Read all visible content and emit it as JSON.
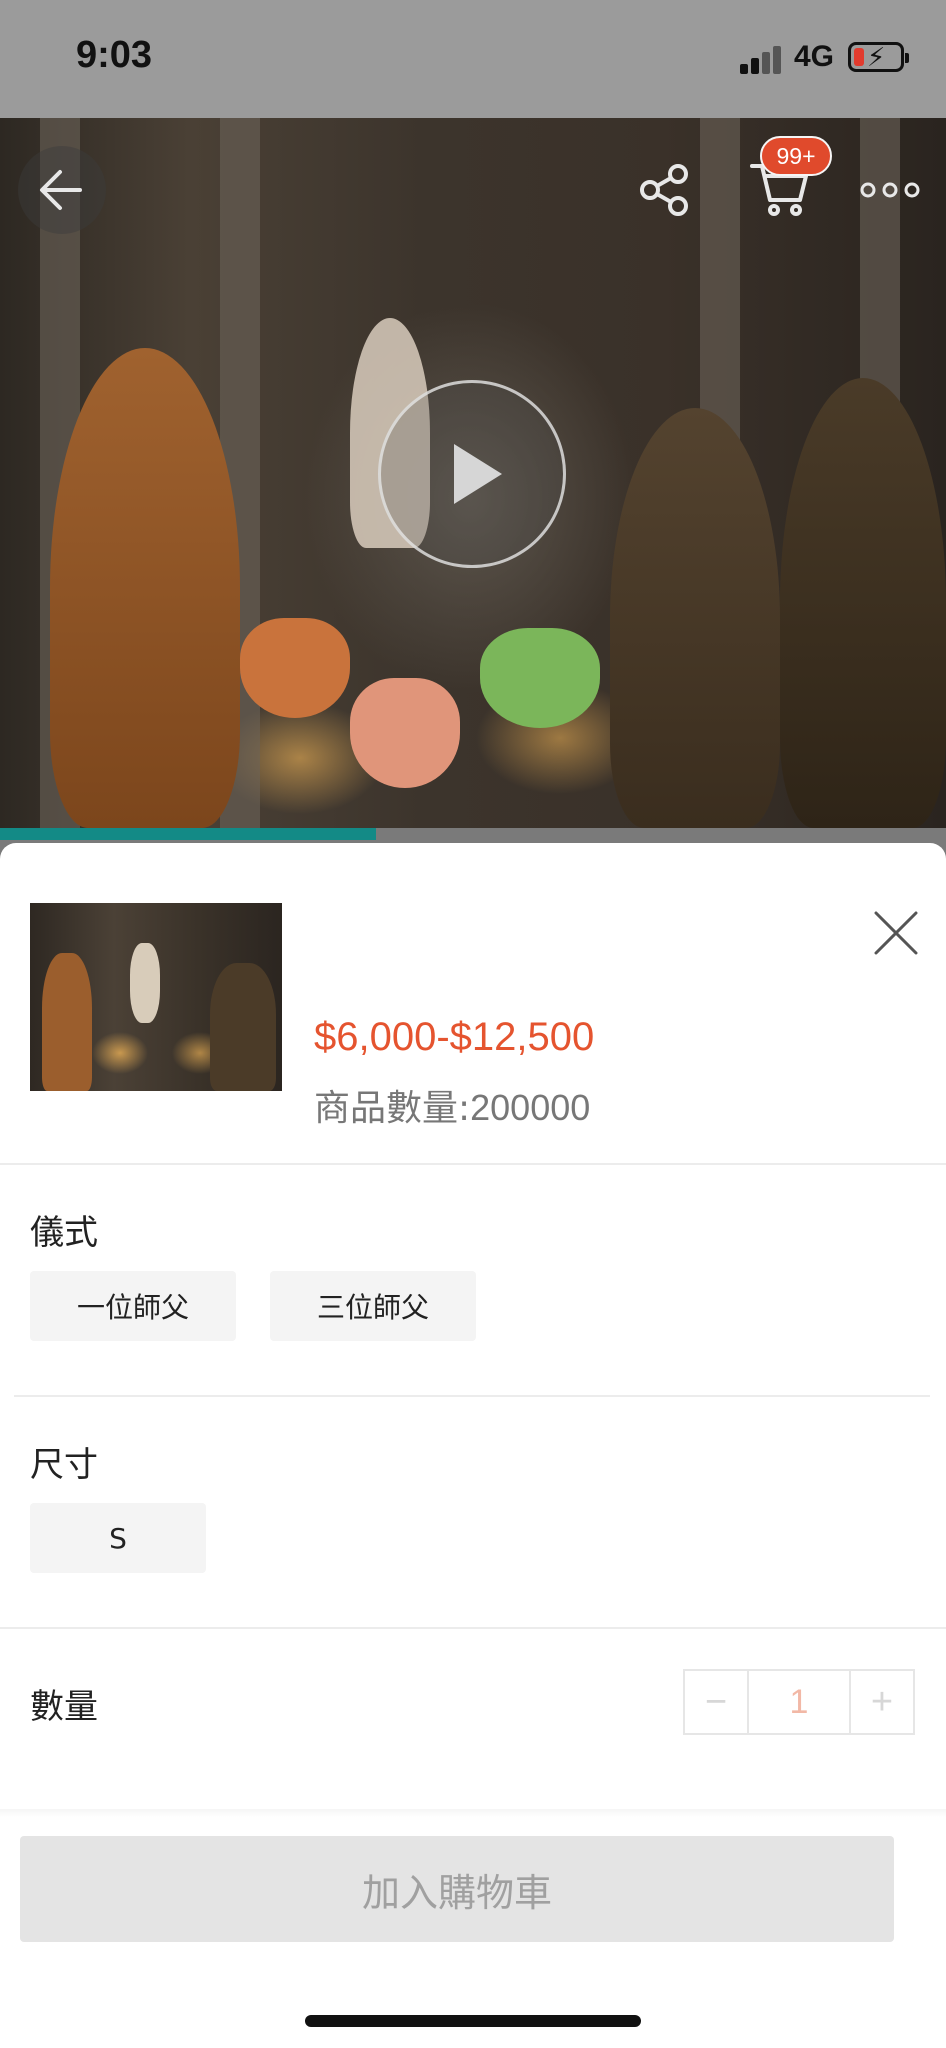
{
  "status_bar": {
    "time": "9:03",
    "network": "4G",
    "battery_level": 0.2,
    "battery_color": "#e23b2e"
  },
  "hero": {
    "icons": {
      "back": "back-arrow-icon",
      "share": "share-icon",
      "cart": "cart-icon",
      "more": "more-icon",
      "play": "play-icon"
    },
    "cart_badge": "99+"
  },
  "product": {
    "price_range": "$6,000-$12,500",
    "stock_label": "商品數量:",
    "stock_value": "200000",
    "price_color": "#e5542f"
  },
  "options": {
    "ritual": {
      "label": "儀式",
      "choices": [
        "一位師父",
        "三位師父"
      ]
    },
    "size": {
      "label": "尺寸",
      "choices": [
        "S"
      ]
    }
  },
  "quantity": {
    "label": "數量",
    "value": "1",
    "decrement": "−",
    "increment": "+"
  },
  "actions": {
    "add_to_cart": "加入購物車"
  }
}
